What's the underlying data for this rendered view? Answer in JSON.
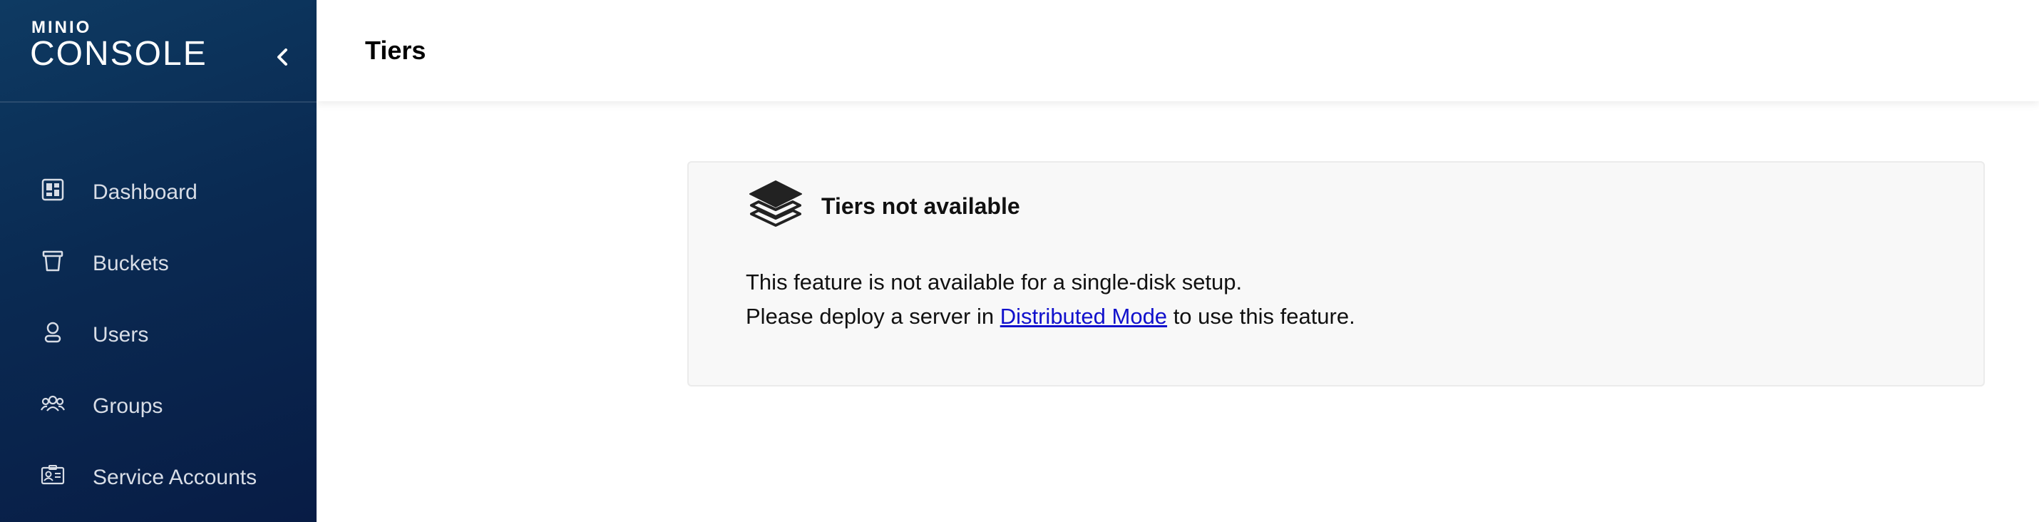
{
  "sidebar": {
    "brand": "MINIO",
    "product": "CONSOLE",
    "items": [
      {
        "label": "Dashboard",
        "icon": "dashboard-icon"
      },
      {
        "label": "Buckets",
        "icon": "bucket-icon"
      },
      {
        "label": "Users",
        "icon": "user-icon"
      },
      {
        "label": "Groups",
        "icon": "groups-icon"
      },
      {
        "label": "Service Accounts",
        "icon": "service-accounts-icon"
      }
    ]
  },
  "header": {
    "title": "Tiers"
  },
  "notice": {
    "icon": "layers-icon",
    "title": "Tiers not available",
    "line1": "This feature is not available for a single-disk setup.",
    "line2_before": "Please deploy a server in",
    "link": "Distributed Mode",
    "line2_after": "to use this feature."
  },
  "colors": {
    "sidebar_bg": "#0a2a52",
    "link": "#1010cc",
    "card_bg": "#f8f8f8"
  }
}
